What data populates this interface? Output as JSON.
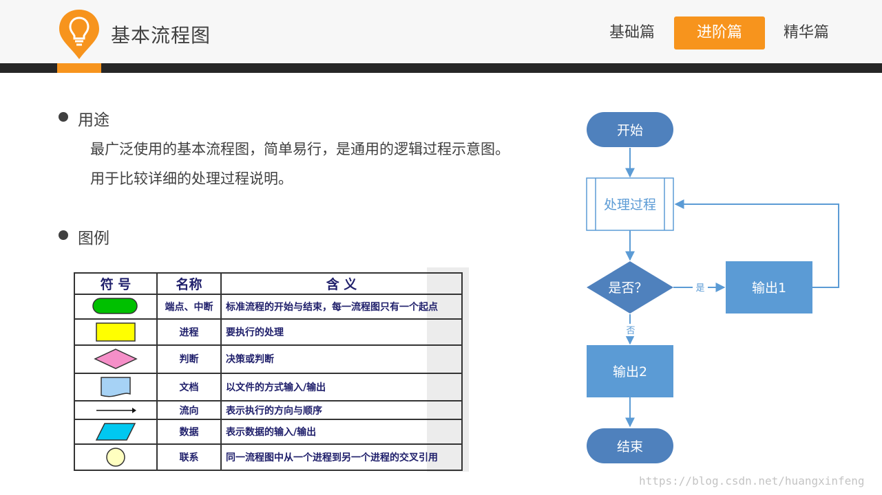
{
  "header": {
    "title": "基本流程图",
    "tabs": [
      {
        "label": "基础篇",
        "active": false
      },
      {
        "label": "进阶篇",
        "active": true
      },
      {
        "label": "精华篇",
        "active": false
      }
    ],
    "accent_color": "#f7941d",
    "logo_icon": "lightbulb-pin-icon"
  },
  "content": {
    "usage": {
      "label": "用途",
      "lines": [
        "最广泛使用的基本流程图，简单易行，是通用的逻辑过程示意图。",
        "用于比较详细的处理过程说明。"
      ]
    },
    "legend_label": "图例"
  },
  "legend_table": {
    "headers": [
      "符  号",
      "名称",
      "含  义"
    ],
    "rows": [
      {
        "symbol": "terminal-symbol",
        "name": "端点、中断",
        "meaning": "标准流程的开始与结束，每一流程图只有一个起点"
      },
      {
        "symbol": "process-symbol",
        "name": "进程",
        "meaning": "要执行的处理"
      },
      {
        "symbol": "decision-symbol",
        "name": "判断",
        "meaning": "决策或判断"
      },
      {
        "symbol": "document-symbol",
        "name": "文档",
        "meaning": "以文件的方式输入/输出"
      },
      {
        "symbol": "flow-arrow-symbol",
        "name": "流向",
        "meaning": "表示执行的方向与顺序"
      },
      {
        "symbol": "data-symbol",
        "name": "数据",
        "meaning": "表示数据的输入/输出"
      },
      {
        "symbol": "connector-symbol",
        "name": "联系",
        "meaning": "同一流程图中从一个进程到另一个进程的交叉引用"
      }
    ]
  },
  "flowchart": {
    "nodes": {
      "start": "开始",
      "process": "处理过程",
      "decision": "是否？",
      "output1": "输出1",
      "output2": "输出2",
      "end": "结束"
    },
    "edge_labels": {
      "yes": "是",
      "no": "否"
    },
    "colors": {
      "terminal": "#4f81bd",
      "box": "#5b9bd5",
      "line": "#5b9bd5"
    }
  },
  "watermark": "https://blog.csdn.net/huangxinfeng"
}
